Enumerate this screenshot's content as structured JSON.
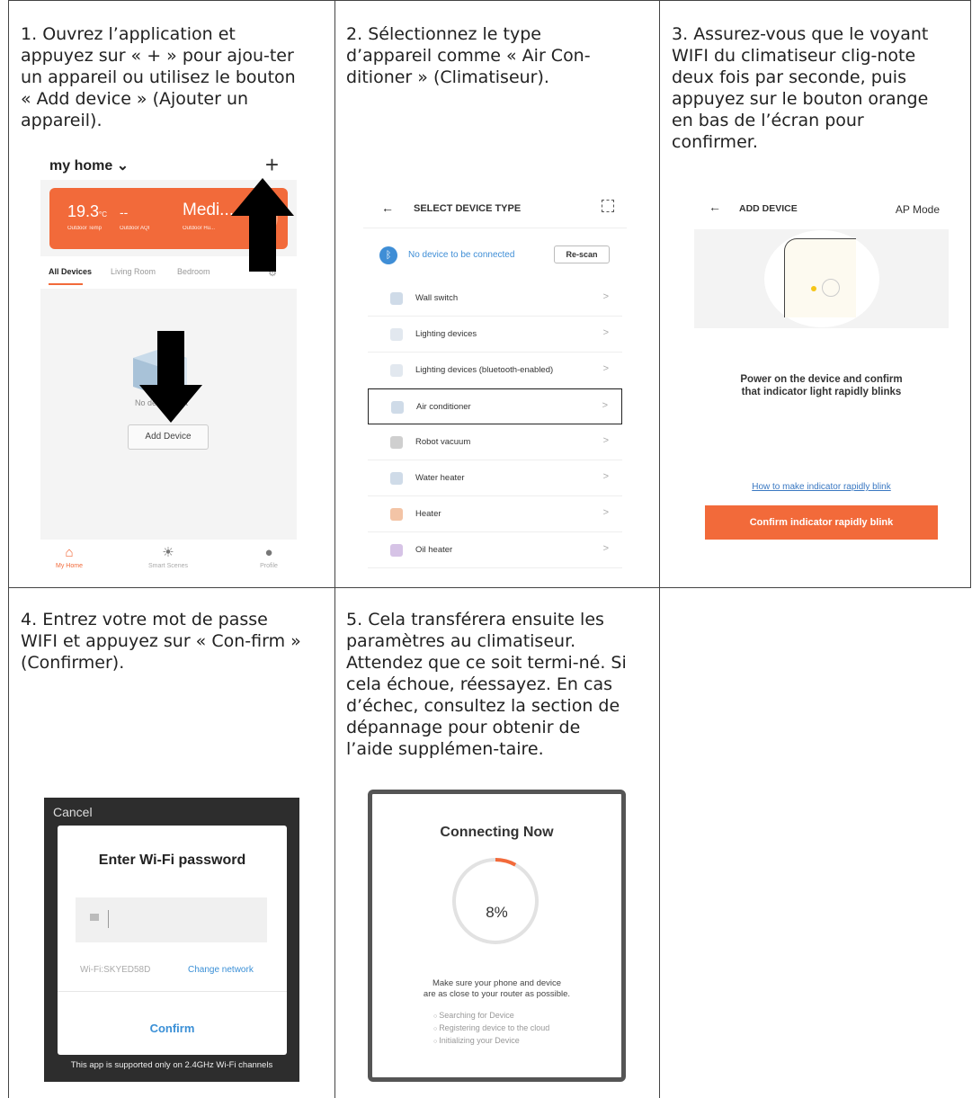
{
  "steps": [
    {
      "number": "1.",
      "text": "Ouvrez l’application et appuyez sur « + » pour ajou-ter un appareil ou utilisez le bouton « Add device » (Ajouter un appareil)."
    },
    {
      "number": "2.",
      "text": "Sélectionnez le type d’appareil comme « Air Con-ditioner » (Climatiseur)."
    },
    {
      "number": "3.",
      "text": "Assurez-vous que le voyant WIFI du climatiseur clig-note deux fois par seconde, puis appuyez sur le bouton orange en bas de l’écran pour confirmer."
    },
    {
      "number": "4.",
      "text": "Entrez votre mot de passe WIFI et appuyez sur « Con-firm » (Confirmer)."
    },
    {
      "number": "5.",
      "text": "Cela transférera ensuite les paramètres au climatiseur. Attendez que ce soit termi-né. Si cela échoue, réessayez. En cas d’échec, consultez la section de dépannage pour obtenir de l’aide supplémen-taire."
    }
  ],
  "screen1": {
    "home_title": "my home ⌄",
    "plus": "+",
    "temp": "19.3",
    "temp_unit": "°C",
    "aqi": "--",
    "humidity": "Medi...",
    "temp_label": "Outdoor Temp",
    "aqi_label": "Outdoor AQI",
    "hum_label": "Outdoor Hu...",
    "tabs": [
      "All Devices",
      "Living Room",
      "Bedroom"
    ],
    "no_devices": "No devices yet",
    "add_device": "Add Device",
    "nav": [
      "My Home",
      "Smart Scenes",
      "Profile"
    ]
  },
  "screen2": {
    "title": "SELECT DEVICE TYPE",
    "back": "←",
    "bt_message": "No device to be connected",
    "rescan": "Re-scan",
    "devices": [
      "Wall switch",
      "Lighting devices",
      "Lighting devices (bluetooth-enabled)",
      "Air conditioner",
      "Robot vacuum",
      "Water heater",
      "Heater",
      "Oil heater"
    ],
    "selected_index": 3,
    "icon_colors": [
      "#cfdbe8",
      "#e2e8ef",
      "#e2e8ef",
      "#cfdbe8",
      "#cfcfcf",
      "#cfdbe8",
      "#f3c4a6",
      "#d6c3e6"
    ]
  },
  "screen3": {
    "title": "ADD DEVICE",
    "back": "←",
    "mode": "AP Mode",
    "message_line1": "Power on the device and confirm",
    "message_line2": "that indicator light rapidly blinks",
    "help_link": "How to make indicator rapidly blink",
    "confirm": "Confirm indicator rapidly blink"
  },
  "screen4": {
    "cancel": "Cancel",
    "title": "Enter Wi-Fi password",
    "ssid": "Wi-Fi:SKYED58D",
    "change_network": "Change network",
    "confirm": "Confirm",
    "footer": "This app is supported only on 2.4GHz Wi-Fi channels"
  },
  "screen5": {
    "title": "Connecting Now",
    "progress_percent": 8,
    "progress_label": "8%",
    "info_line1": "Make sure your phone and device",
    "info_line2": "are as close to your router as possible.",
    "steps": [
      "Searching for Device",
      "Registering device to the cloud",
      "Initializing your Device"
    ]
  },
  "colors": {
    "accent": "#f26a3a",
    "link": "#3a8fd6"
  }
}
